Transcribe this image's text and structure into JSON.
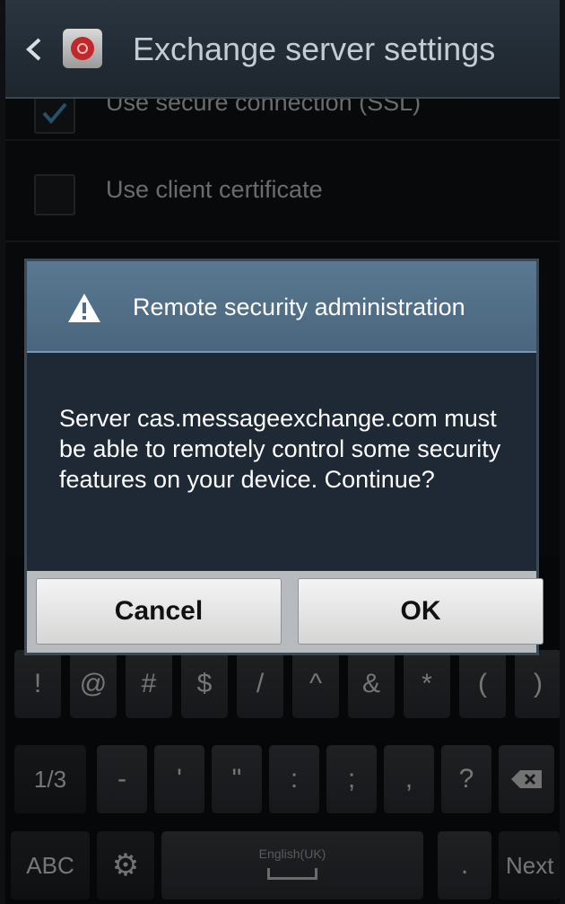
{
  "header": {
    "title": "Exchange server settings",
    "back_icon": "chevron-left-icon",
    "app_icon": "email-app-icon"
  },
  "settings": {
    "ssl_label": "Use secure connection (SSL)",
    "ssl_checked": true,
    "cert_label": "Use client certificate",
    "cert_checked": false
  },
  "dialog": {
    "title": "Remote security administration",
    "icon": "warning-icon",
    "message": "Server cas.messageexchange.com must be able to remotely control some security features on your device. Continue?",
    "cancel_label": "Cancel",
    "ok_label": "OK"
  },
  "keyboard": {
    "row1": [
      "!",
      "@",
      "#",
      "$",
      "/",
      "^",
      "&",
      "*",
      "(",
      ")"
    ],
    "row2": [
      "1/3",
      "-",
      "'",
      "\"",
      ":",
      ";",
      ",",
      "?"
    ],
    "abc_label": "ABC",
    "space_label": "English(UK)",
    "period_label": ".",
    "next_label": "Next"
  }
}
